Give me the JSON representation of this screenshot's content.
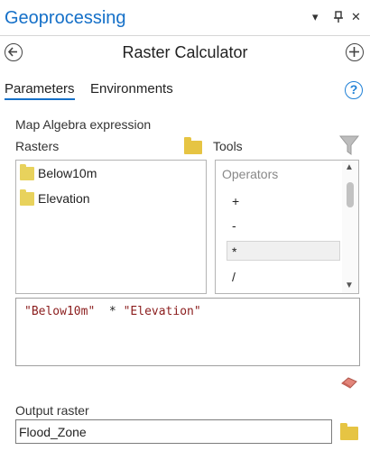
{
  "pane": {
    "title": "Geoprocessing",
    "menu_glyph": "▾",
    "pin_glyph": "⊥",
    "close_glyph": "✕"
  },
  "tool": {
    "title": "Raster Calculator",
    "back_icon": "arrow-left-icon",
    "add_icon": "plus-circle-icon"
  },
  "tabs": [
    {
      "label": "Parameters",
      "active": true
    },
    {
      "label": "Environments",
      "active": false
    }
  ],
  "help_glyph": "?",
  "expression_label": "Map Algebra expression",
  "rasters": {
    "label": "Rasters",
    "items": [
      "Below10m",
      "Elevation"
    ]
  },
  "tools": {
    "label": "Tools",
    "ops_title": "Operators",
    "operators": [
      "+",
      "-",
      "*",
      "/"
    ],
    "selected": "*"
  },
  "expression": {
    "part1": "\"Below10m\"",
    "op": "  * ",
    "part2": "\"Elevation\""
  },
  "output": {
    "label": "Output raster",
    "value": "Flood_Zone"
  },
  "colors": {
    "accent": "#1570c8",
    "folder": "#e8d25c",
    "expression_string": "#8b1d1d"
  }
}
